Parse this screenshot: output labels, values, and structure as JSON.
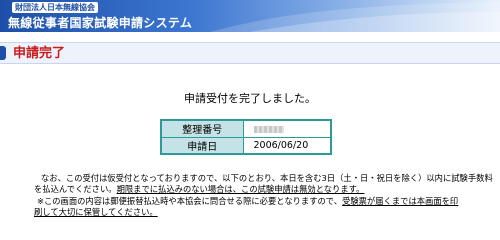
{
  "header": {
    "org_name": "財団法人日本無線協会",
    "system_title": "無線従事者国家試験申請システム",
    "colors": {
      "primary": "#1d4fa8",
      "accent_red": "#cc1a1a",
      "table_border": "#2d9a9a",
      "table_header_bg": "#c5e3e6"
    }
  },
  "page": {
    "title": "申請完了",
    "message": "申請受付を完了しました。"
  },
  "details": {
    "reference_label": "整理番号",
    "reference_value": "",
    "date_label": "申請日",
    "date_value": "2006/06/20"
  },
  "notes": {
    "line1a": "なお、この受付は仮受付となっておりますので、以下のとおり、本日を含む3日（土・日・祝日を除く）以内に試験手数料",
    "line1b_pre": "を払込んでください。",
    "line1b_ul": "期限までに払込みのない場合は、この試験申請は無効となります。",
    "line2a_pre": "※この画面の内容は郵便振替払込時や本協会に問合せる際に必要となりますので、",
    "line2a_ul": "受験票が届くまでは本画面を印",
    "line2b": "刷して大切に保管してください。"
  }
}
